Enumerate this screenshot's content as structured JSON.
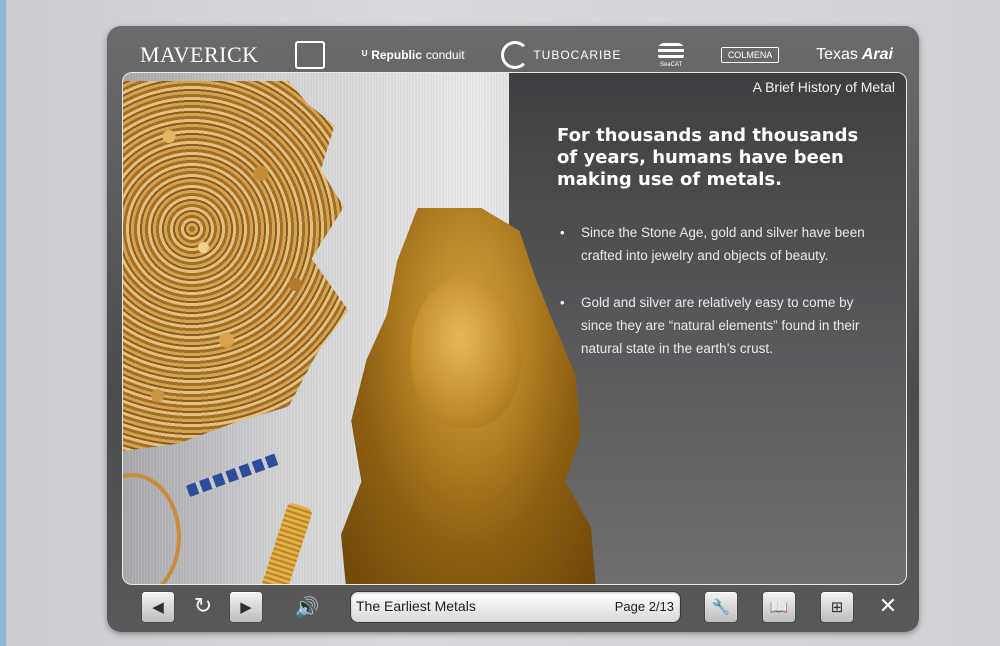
{
  "header": {
    "logos": {
      "maverick": "MAVERICK",
      "republic_bold": "Republic",
      "republic_thin": "conduit",
      "tubocaribe": "TUBOCARIBE",
      "seacat": "SeaCAT",
      "colmena": "COLMENA",
      "texas": "Texas",
      "arai": "Arai"
    }
  },
  "slide": {
    "section_title": "A Brief History of Metal",
    "headline": "For thousands and thousands of years, humans have been making use of metals.",
    "bullet_glyph": "•",
    "bullets": [
      "Since the Stone Age, gold and silver have been crafted into jewelry and objects of beauty.",
      "Gold and silver are relatively easy to come by since they are “natural elements” found in their natural state in the earth’s crust."
    ]
  },
  "toolbar": {
    "chapter_title": "The Earliest Metals",
    "page_indicator": "Page 2/13",
    "icons": {
      "back": "back-arrow-icon",
      "replay": "replay-icon",
      "next": "next-arrow-icon",
      "audio": "speaker-icon",
      "tools": "wrench-icon",
      "glossary": "book-icon",
      "sitemap": "sitemap-icon",
      "close": "close-icon"
    },
    "glyphs": {
      "back": "◀",
      "replay": "↻",
      "next": "▶",
      "audio": "🔊",
      "tools": "🔧",
      "glossary": "📖",
      "sitemap": "⊞",
      "close": "✕"
    }
  },
  "colors": {
    "frame": "#555557",
    "panel_dark": "#4a4a4d",
    "gold": "#c3902e",
    "text_light": "#ffffff"
  }
}
